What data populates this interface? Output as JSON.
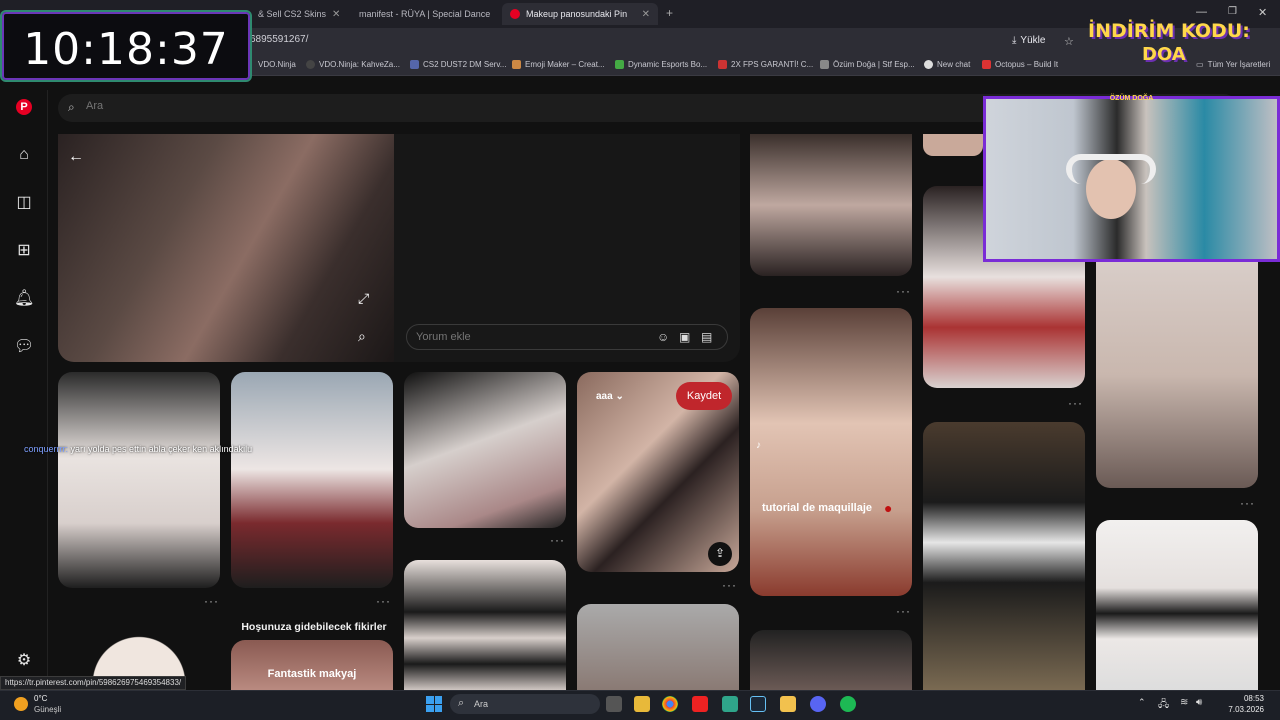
{
  "clock": {
    "time": "10:18:37"
  },
  "browser": {
    "tabs": [
      {
        "label": "& Sell CS2 Skins",
        "active": false
      },
      {
        "label": "manifest - RÜYA | Special Dance",
        "active": false
      },
      {
        "label": "Makeup panosundaki Pin",
        "active": true
      }
    ],
    "url_fragment": "6895591267/",
    "load_label": "Yükle",
    "bookmarks": [
      "VDO.Ninja",
      "VDO.Ninja: KahveZa...",
      "CS2 DUST2 DM Serv...",
      "Emoji Maker – Creat...",
      "Dynamic Esports Bo...",
      "2X FPS GARANTİ! C...",
      "Özüm Doğa | Stf Esp...",
      "New chat",
      "Octopus – Build It"
    ],
    "all_bookmarks": "Tüm Yer İşaretleri"
  },
  "promo": {
    "line1": "İNDİRİM KODU:",
    "line2": "DOA"
  },
  "webcam": {
    "label": "ÖZÜM DOĞA"
  },
  "pinterest": {
    "search_placeholder": "Ara",
    "comment_placeholder": "Yorum ekle",
    "save_label": "Kaydet",
    "board_label": "aaa",
    "pin_caption_tutorial": "tutorial de maquillaje",
    "suggest_title": "Hoşunuza gidebilecek fikirler",
    "suggest_caption": "Fantastik makyaj",
    "more": "···"
  },
  "chat": {
    "user": "conquerrrr:",
    "message": "yarı yolda pes ettin abla çeker ken aklındakilu"
  },
  "status_url": "https://tr.pinterest.com/pin/598626975469354833/",
  "taskbar": {
    "temp": "0°C",
    "weather": "Güneşli",
    "search": "Ara",
    "time": "08:53",
    "date": "7.03.2026"
  },
  "colors": {
    "accent": "#c0262c",
    "stream_border": "#7a2cd6",
    "promo": "#ffd84a"
  }
}
